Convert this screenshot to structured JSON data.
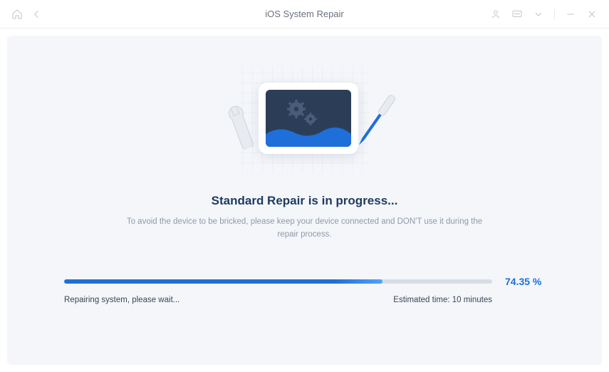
{
  "titlebar": {
    "title": "iOS System Repair"
  },
  "main": {
    "heading": "Standard Repair is in progress...",
    "subtext": "To avoid the device to be bricked, please keep your device connected and DON'T use it during the repair process."
  },
  "progress": {
    "percent_value": 74.35,
    "percent_label": "74.35 %",
    "status_text": "Repairing system, please wait...",
    "eta_label": "Estimated time: 10 minutes"
  }
}
